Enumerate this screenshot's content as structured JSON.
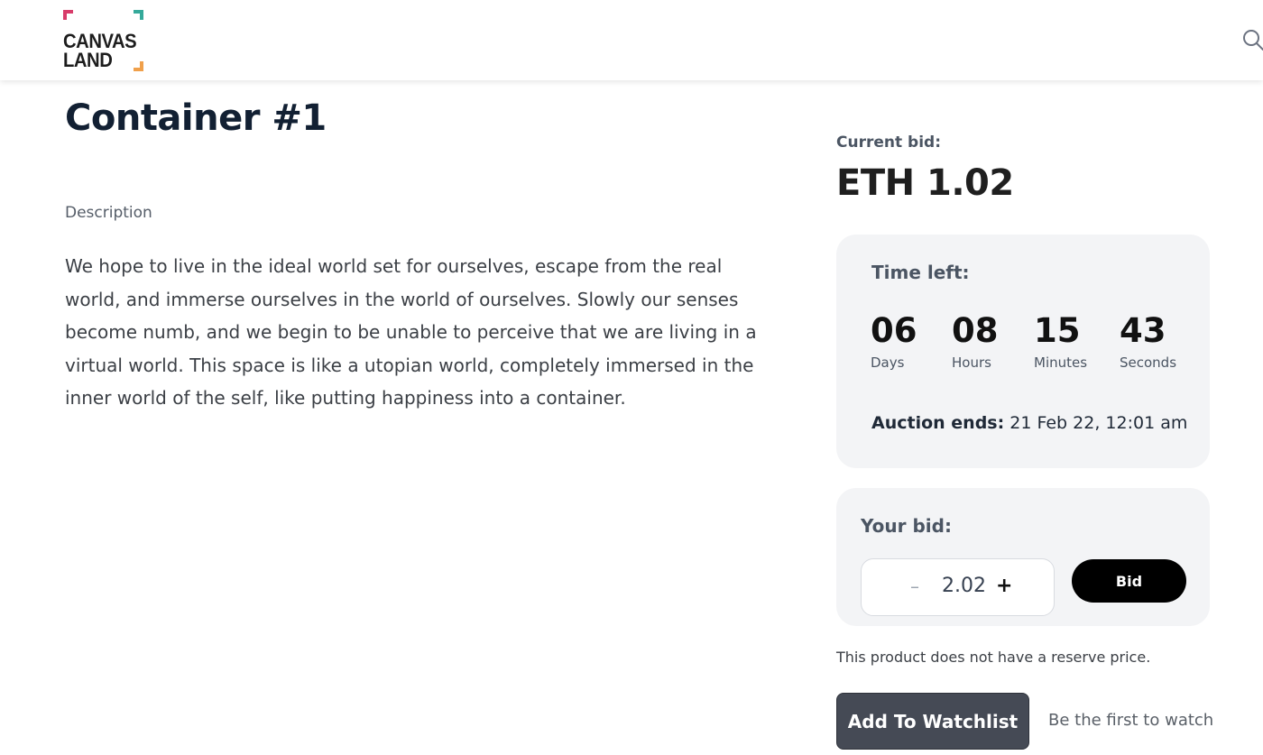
{
  "header": {
    "logo_line1": "CANVAS",
    "logo_line2": "LAND",
    "search_icon": "search-icon"
  },
  "product": {
    "title": "Container #1",
    "description_label": "Description",
    "description": "We hope to live in the ideal world set for ourselves, escape from the real world, and immerse ourselves in the world of ourselves. Slowly our senses become numb, and we begin to be unable to perceive that we are living in a virtual world. This space is like a utopian world, completely immersed in the inner world of the self, like putting happiness into a container."
  },
  "bid": {
    "current_label": "Current bid:",
    "current_value": "ETH 1.02",
    "time_left_label": "Time left:",
    "countdown": [
      {
        "value": "06",
        "label": "Days"
      },
      {
        "value": "08",
        "label": "Hours"
      },
      {
        "value": "15",
        "label": "Minutes"
      },
      {
        "value": "43",
        "label": "Seconds"
      }
    ],
    "auction_ends_label": "Auction ends:",
    "auction_ends_value": "21 Feb 22, 12:01 am",
    "your_bid_label": "Your bid:",
    "minus": "–",
    "amount": "2.02",
    "plus": "+",
    "bid_button": "Bid",
    "reserve_note": "This product does not have a reserve price.",
    "watchlist_button": "Add To Watchlist",
    "first_watch": "Be the first to watch"
  },
  "colors": {
    "logo_pink": "#d83c6a",
    "logo_teal": "#35a99a",
    "logo_orange": "#f0a04b",
    "panel_bg": "#f3f4f6",
    "watch_button_bg": "#454a55"
  }
}
